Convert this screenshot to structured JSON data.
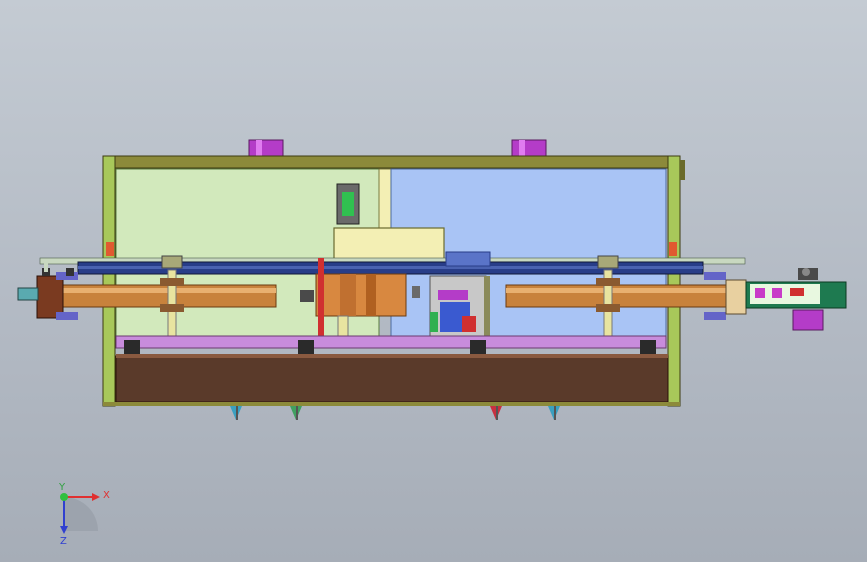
{
  "app": {
    "view": "Front"
  },
  "triad": {
    "x_label": "X",
    "y_label": "Y",
    "z_label": "Z"
  },
  "colors": {
    "background": "#b8bfc9",
    "frame_olive": "#8c8a3a",
    "frame_green": "#a8c85a",
    "panel_green": "#d2e9bc",
    "panel_blue": "#a9c4f5",
    "base_brown": "#5a3a2a",
    "track_blue": "#283d88",
    "belt_copper": "#c8823c",
    "motor_purple": "#b43cc8",
    "bracket_purple": "#c88cdc",
    "box_yellow": "#f3efb4",
    "axis_red": "#e03030",
    "axis_green": "#30c040",
    "axis_blue": "#3040d0"
  }
}
